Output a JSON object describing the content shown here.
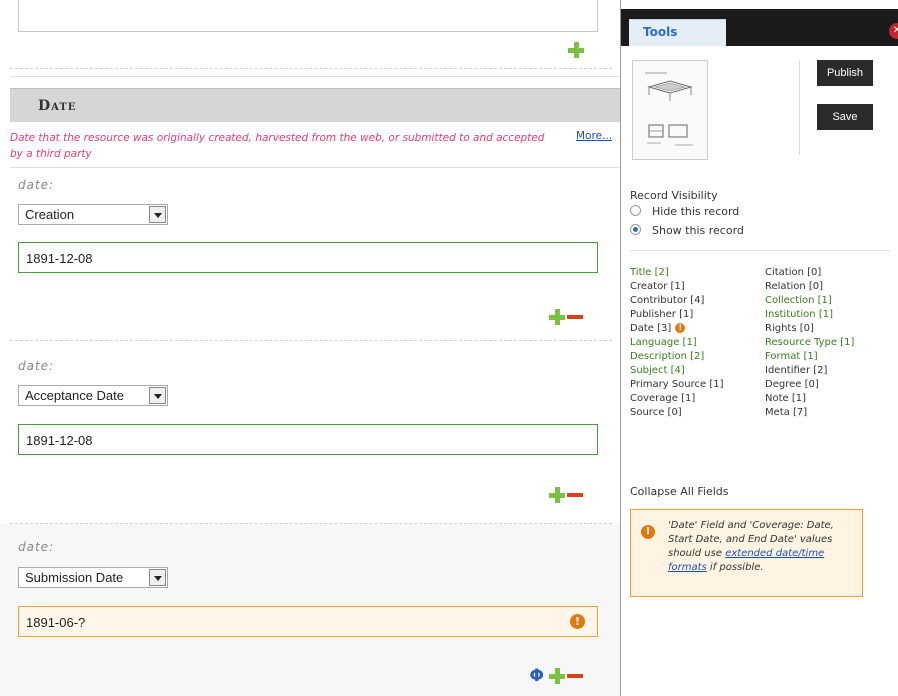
{
  "editor": {
    "section_title": "Date",
    "description": "Date that the resource was originally created, harvested from the web, or submitted to and accepted by a third party",
    "more_label": "More...",
    "field_label": "date:",
    "entries": [
      {
        "qualifier": "Creation",
        "value": "1891-12-08"
      },
      {
        "qualifier": "Acceptance Date",
        "value": "1891-12-08"
      },
      {
        "qualifier": "Submission Date",
        "value": "1891-06-?"
      }
    ],
    "phi_symbol": "Φ"
  },
  "tools": {
    "tab_label": "Tools",
    "publish_label": "Publish",
    "save_label": "Save",
    "visibility": {
      "title": "Record Visibility",
      "options": [
        "Hide this record",
        "Show this record"
      ],
      "selected": "Show this record"
    },
    "fields_left": [
      {
        "name": "Title",
        "count": "[2]",
        "filled": true
      },
      {
        "name": "Creator",
        "count": "[1]",
        "filled": false
      },
      {
        "name": "Contributor",
        "count": "[4]",
        "filled": false
      },
      {
        "name": "Publisher",
        "count": "[1]",
        "filled": false
      },
      {
        "name": "Date",
        "count": "[3]",
        "filled": false,
        "warning": true
      },
      {
        "name": "Language",
        "count": "[1]",
        "filled": true
      },
      {
        "name": "Description",
        "count": "[2]",
        "filled": true
      },
      {
        "name": "Subject",
        "count": "[4]",
        "filled": true
      },
      {
        "name": "Primary Source",
        "count": "[1]",
        "filled": false
      },
      {
        "name": "Coverage",
        "count": "[1]",
        "filled": false
      },
      {
        "name": "Source",
        "count": "[0]",
        "filled": false
      }
    ],
    "fields_right": [
      {
        "name": "Citation",
        "count": "[0]",
        "filled": false
      },
      {
        "name": "Relation",
        "count": "[0]",
        "filled": false
      },
      {
        "name": "Collection",
        "count": "[1]",
        "filled": true
      },
      {
        "name": "Institution",
        "count": "[1]",
        "filled": true
      },
      {
        "name": "Rights",
        "count": "[0]",
        "filled": false
      },
      {
        "name": "Resource Type",
        "count": "[1]",
        "filled": true
      },
      {
        "name": "Format",
        "count": "[1]",
        "filled": true
      },
      {
        "name": "Identifier",
        "count": "[2]",
        "filled": false
      },
      {
        "name": "Degree",
        "count": "[0]",
        "filled": false
      },
      {
        "name": "Note",
        "count": "[1]",
        "filled": false
      },
      {
        "name": "Meta",
        "count": "[7]",
        "filled": false
      }
    ],
    "collapse_label": "Collapse All Fields",
    "notice": {
      "text_before": "'Date' Field and 'Coverage: Date, Start Date, and End Date' values should use ",
      "link_text": "extended date/time formats",
      "text_after": " if possible."
    }
  },
  "colors": {
    "filled_field": "#3a7d1c",
    "warning": "#e07a12",
    "description": "#e8397a",
    "input_border": "#4a9c3a"
  }
}
